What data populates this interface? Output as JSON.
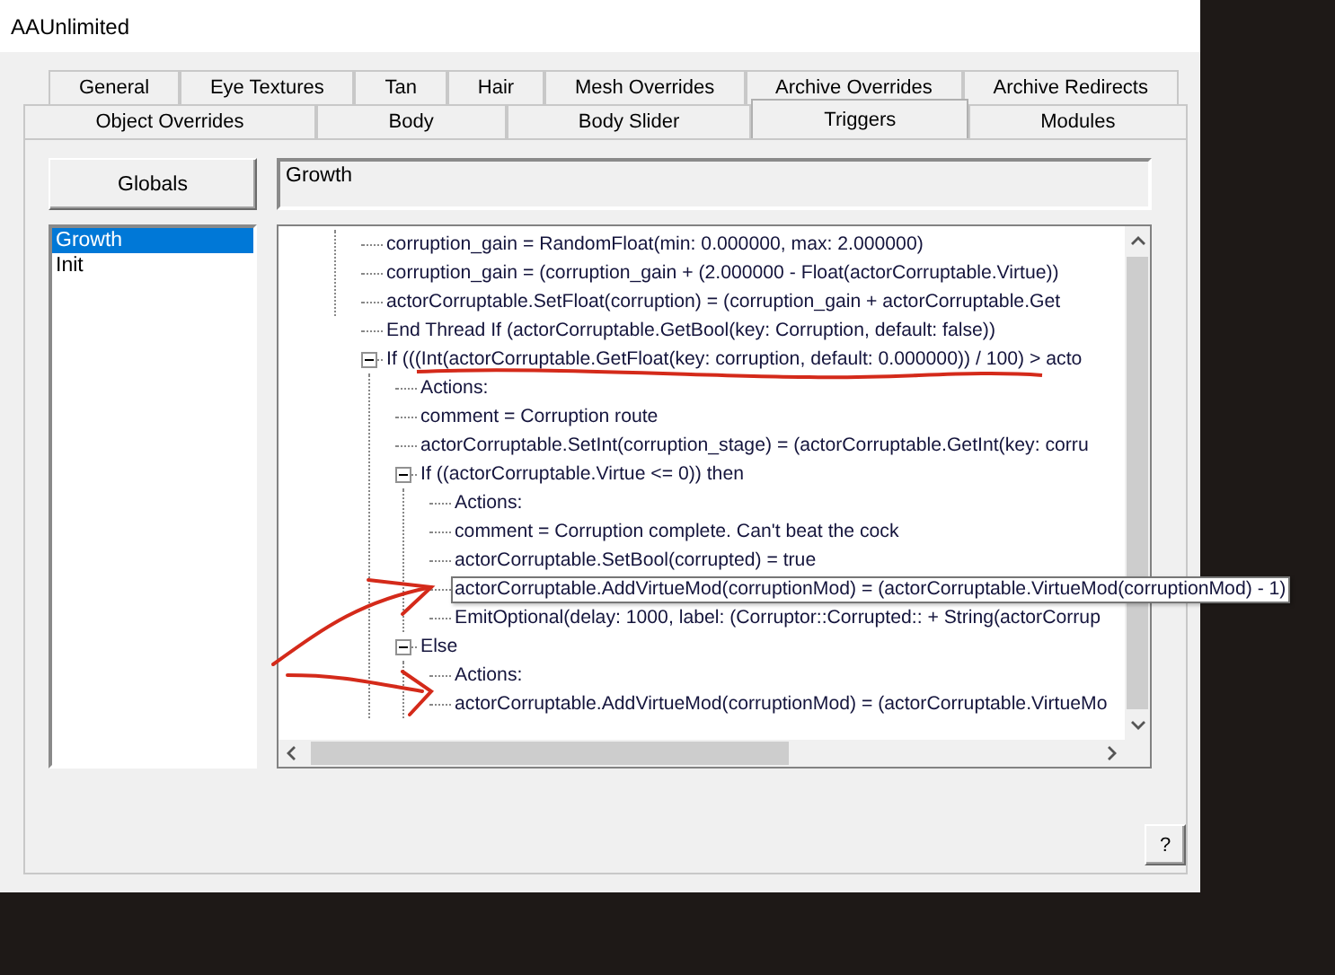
{
  "window": {
    "title": "AAUnlimited"
  },
  "tab_rows": [
    [
      {
        "label": "General",
        "selected": false
      },
      {
        "label": "Eye Textures",
        "selected": false
      },
      {
        "label": "Tan",
        "selected": false
      },
      {
        "label": "Hair",
        "selected": false
      },
      {
        "label": "Mesh Overrides",
        "selected": false
      },
      {
        "label": "Archive Overrides",
        "selected": false
      },
      {
        "label": "Archive Redirects",
        "selected": false
      }
    ],
    [
      {
        "label": "Object Overrides",
        "selected": false
      },
      {
        "label": "Body",
        "selected": false
      },
      {
        "label": "Body Slider",
        "selected": false
      },
      {
        "label": "Triggers",
        "selected": true
      },
      {
        "label": "Modules",
        "selected": false
      }
    ]
  ],
  "globals_button": "Globals",
  "trigger_name": {
    "value": "Growth"
  },
  "triggers": [
    {
      "label": "Growth",
      "selected": true
    },
    {
      "label": "Init",
      "selected": false
    }
  ],
  "tree": {
    "clipped_children": [
      {
        "text": "corruption_gain = RandomFloat(min: 0.000000, max: 2.000000)",
        "selected": false
      },
      {
        "text": "corruption_gain = (corruption_gain + (2.000000 - Float(actorCorruptable.Virtue))",
        "selected": false
      },
      {
        "text": "actorCorruptable.SetFloat(corruption) = (corruption_gain + actorCorruptable.Get",
        "selected": false
      }
    ],
    "items": [
      {
        "text": "End Thread If (actorCorruptable.GetBool(key: Corruption, default: false))",
        "selected": false
      },
      {
        "text": "If (((Int(actorCorruptable.GetFloat(key: corruption, default: 0.000000)) / 100) > acto",
        "selected": false,
        "expanded": true,
        "children": [
          {
            "text": "Actions:",
            "selected": false
          },
          {
            "text": "comment = Corruption route",
            "selected": false
          },
          {
            "text": "actorCorruptable.SetInt(corruption_stage) = (actorCorruptable.GetInt(key: corru",
            "selected": false
          },
          {
            "text": "If ((actorCorruptable.Virtue <= 0)) then",
            "selected": false,
            "expanded": true,
            "children": [
              {
                "text": "Actions:",
                "selected": false
              },
              {
                "text": "comment = Corruption complete. Can't beat the cock",
                "selected": false
              },
              {
                "text": "actorCorruptable.SetBool(corrupted) = true",
                "selected": false
              },
              {
                "text": "actorCorruptable.AddVirtueMod(corruptionMod) = (actorCorruptable.VirtueMod(corruptionMod) - 1)",
                "selected": true
              },
              {
                "text": "EmitOptional(delay: 1000, label: (Corruptor::Corrupted:: + String(actorCorrup",
                "selected": false
              }
            ]
          },
          {
            "text": "Else",
            "selected": false,
            "expanded": true,
            "children": [
              {
                "text": "Actions:",
                "selected": false
              },
              {
                "text": "actorCorruptable.AddVirtueMod(corruptionMod) = (actorCorruptable.VirtueMo",
                "selected": false
              }
            ]
          }
        ]
      }
    ]
  },
  "help_button": "?"
}
